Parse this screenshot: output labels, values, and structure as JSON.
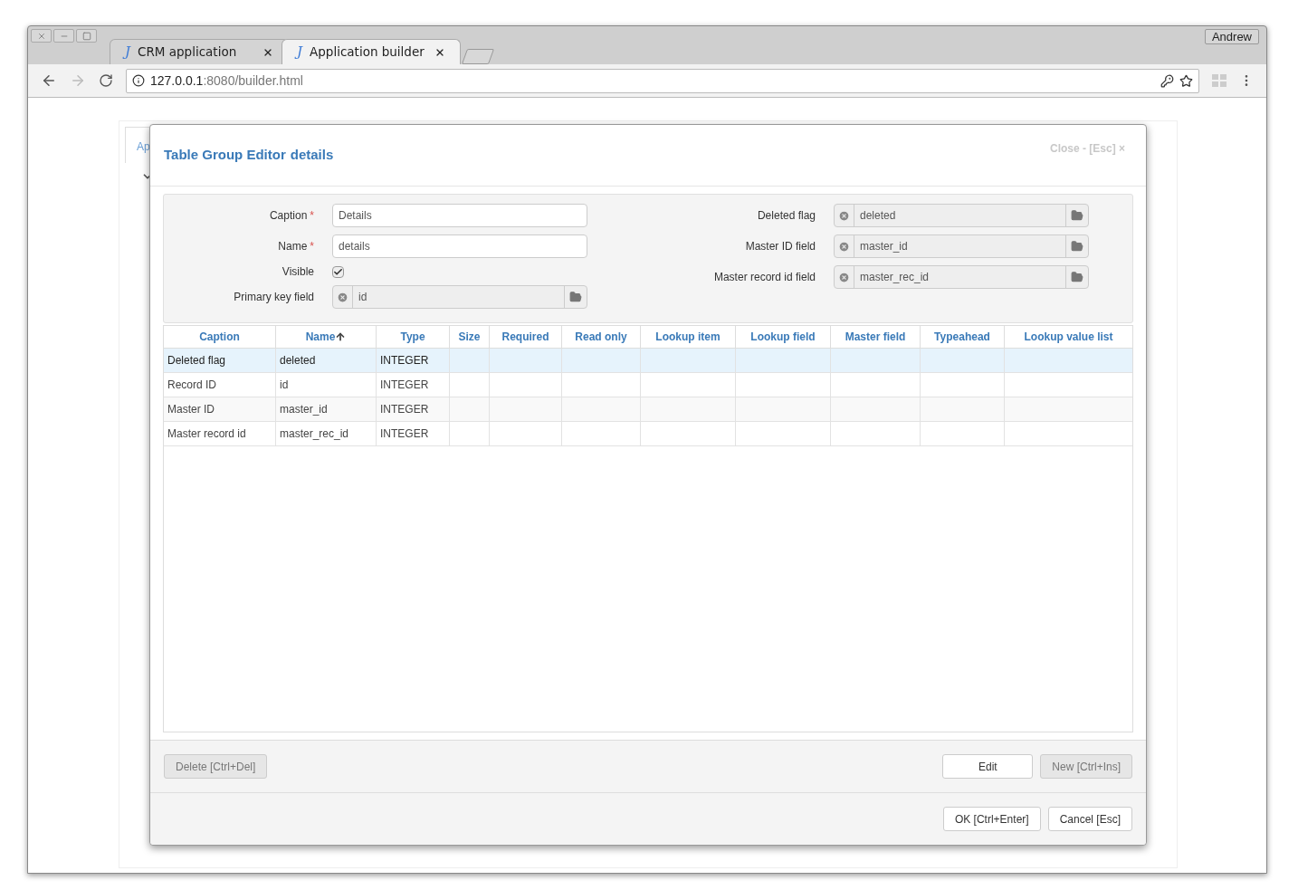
{
  "browser": {
    "tabs": [
      {
        "icon": "J",
        "title": "CRM application",
        "selected": false
      },
      {
        "icon": "J",
        "title": "Application builder",
        "selected": true
      }
    ],
    "user": "Andrew",
    "address": {
      "host": "127.0.0.1",
      "path": ":8080/builder.html"
    }
  },
  "background_page": {
    "tab_label": "Ap"
  },
  "dialog": {
    "title": "Table Group Editor",
    "subtitle": "details",
    "close": "Close - [Esc] ×",
    "left_fields": [
      {
        "label": "Caption",
        "mark": "*",
        "kind": "text",
        "value": "Details"
      },
      {
        "label": "Name",
        "mark": "*",
        "kind": "text",
        "value": "details"
      },
      {
        "label": "Visible",
        "kind": "checkbox",
        "checked": true
      },
      {
        "label": "Primary key field",
        "kind": "lookup",
        "value": "id"
      }
    ],
    "right_fields": [
      {
        "label": "Deleted flag",
        "kind": "lookup",
        "value": "deleted"
      },
      {
        "label": "Master ID field",
        "kind": "lookup",
        "value": "master_id"
      },
      {
        "label": "Master record id field",
        "kind": "lookup",
        "value": "master_rec_id"
      }
    ],
    "table": {
      "columns": [
        {
          "label": "Caption",
          "sorted": false
        },
        {
          "label": "Name",
          "sorted": true
        },
        {
          "label": "Type",
          "sorted": false
        },
        {
          "label": "Size",
          "sorted": false
        },
        {
          "label": "Required",
          "sorted": false
        },
        {
          "label": "Read only",
          "sorted": false
        },
        {
          "label": "Lookup item",
          "sorted": false
        },
        {
          "label": "Lookup field",
          "sorted": false
        },
        {
          "label": "Master field",
          "sorted": false
        },
        {
          "label": "Typeahead",
          "sorted": false
        },
        {
          "label": "Lookup value list",
          "sorted": false
        }
      ],
      "rows": [
        {
          "cells": [
            "Deleted flag",
            "deleted",
            "INTEGER"
          ],
          "selected": true
        },
        {
          "cells": [
            "Record ID",
            "id",
            "INTEGER"
          ],
          "selected": false
        },
        {
          "cells": [
            "Master ID",
            "master_id",
            "INTEGER"
          ],
          "selected": false
        },
        {
          "cells": [
            "Master record id",
            "master_rec_id",
            "INTEGER"
          ],
          "selected": false
        }
      ]
    },
    "table_buttons_left": [
      {
        "label": "Delete [Ctrl+Del]",
        "disabled": true
      }
    ],
    "table_buttons_right": [
      {
        "label": "Edit",
        "disabled": false
      },
      {
        "label": "New [Ctrl+Ins]",
        "disabled": true
      }
    ],
    "footer_buttons": [
      {
        "label": "OK [Ctrl+Enter]",
        "disabled": false
      },
      {
        "label": "Cancel [Esc]",
        "disabled": false
      }
    ]
  }
}
